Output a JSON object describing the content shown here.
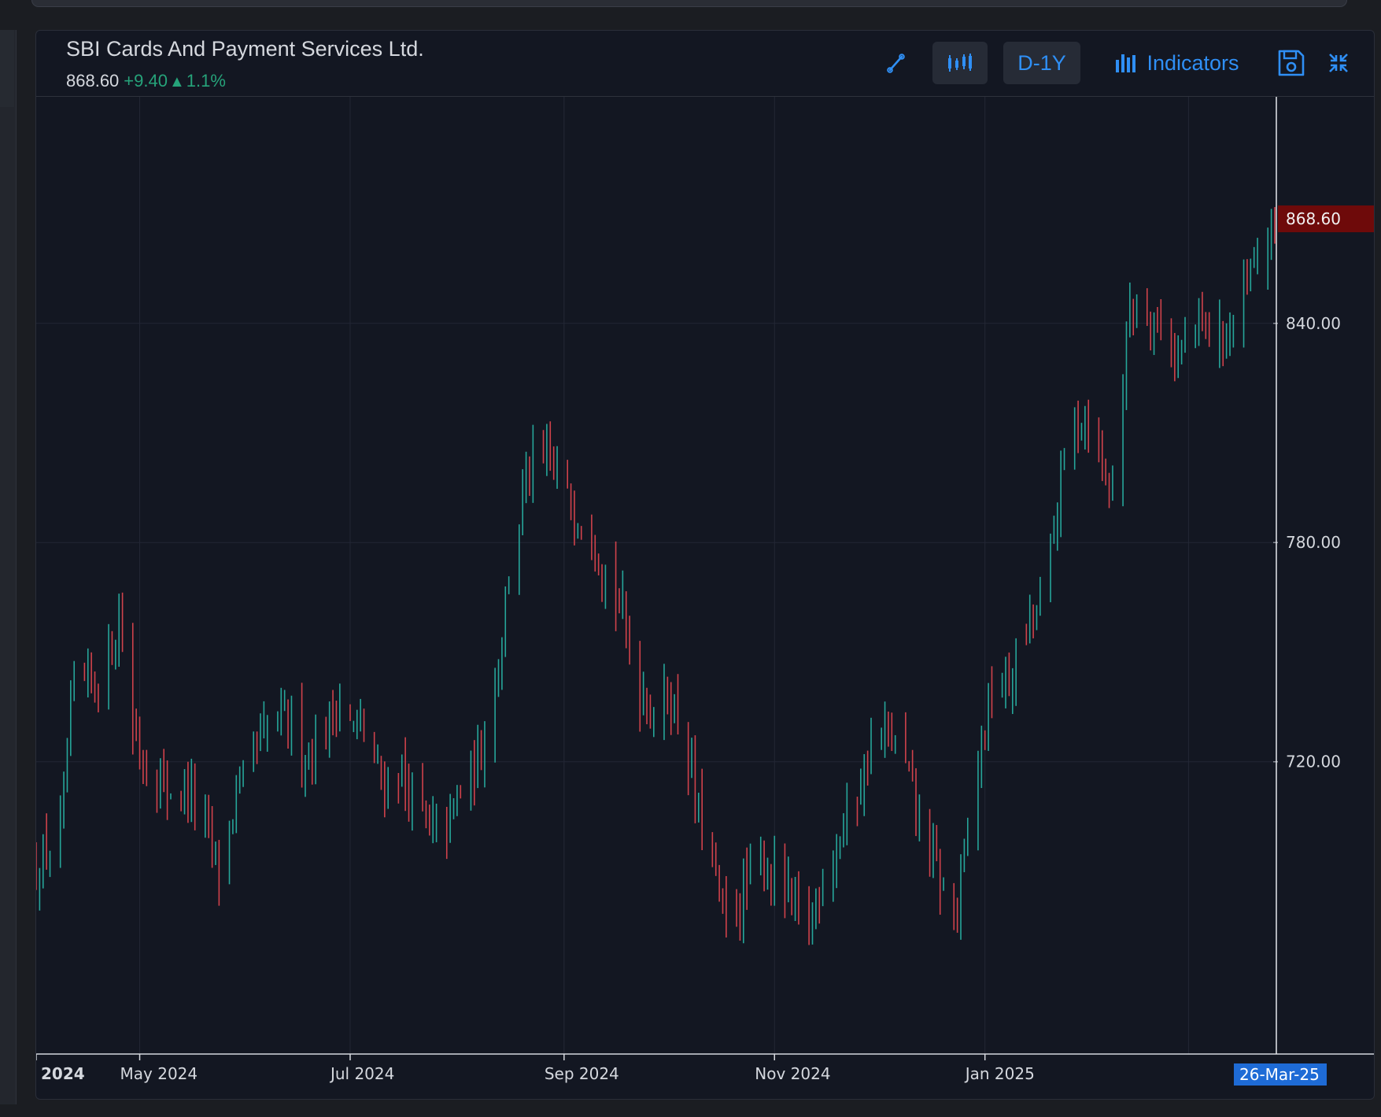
{
  "header": {
    "title": "SBI Cards And Payment Services Ltd.",
    "last_price": "868.60",
    "change": "+9.40",
    "change_pct": "1.1%",
    "change_arrow": "▲"
  },
  "toolbar": {
    "draw_icon": "trendline-icon",
    "chart_type_icon": "ohlc-bars-icon",
    "period_label": "D-1Y",
    "indicators_label": "Indicators",
    "save_icon": "save-icon",
    "collapse_icon": "collapse-icon"
  },
  "colors": {
    "up": "#26a69a",
    "down": "#d0424b",
    "background": "#131722",
    "accent": "#2f8ff5",
    "last_price_label_bg": "#6e0a0a"
  },
  "chart_data": {
    "type": "ohlc",
    "title": "",
    "xlabel": "",
    "ylabel": "",
    "ylim": [
      640,
      902
    ],
    "y_ticks": [
      "720.00",
      "780.00",
      "840.00"
    ],
    "x_ticks": [
      "2024",
      "May 2024",
      "Jul 2024",
      "Sep 2024",
      "Nov 2024",
      "Jan 2025"
    ],
    "x_range": [
      "2024-04-01",
      "2025-03-26"
    ],
    "last_price_label": "868.60",
    "crosshair_date": "26-Mar-25",
    "grid": true,
    "series": [
      {
        "name": "",
        "close_path": [
          [
            "2024-04-01",
            690
          ],
          [
            "2024-04-08",
            700
          ],
          [
            "2024-04-12",
            740
          ],
          [
            "2024-04-18",
            742
          ],
          [
            "2024-04-22",
            748
          ],
          [
            "2024-04-25",
            760
          ],
          [
            "2024-04-29",
            730
          ],
          [
            "2024-05-03",
            718
          ],
          [
            "2024-05-08",
            713
          ],
          [
            "2024-05-15",
            712
          ],
          [
            "2024-05-20",
            702
          ],
          [
            "2024-05-24",
            690
          ],
          [
            "2024-05-29",
            710
          ],
          [
            "2024-06-04",
            723
          ],
          [
            "2024-06-10",
            732
          ],
          [
            "2024-06-14",
            730
          ],
          [
            "2024-06-18",
            722
          ],
          [
            "2024-06-24",
            728
          ],
          [
            "2024-06-27",
            738
          ],
          [
            "2024-07-01",
            730
          ],
          [
            "2024-07-05",
            728
          ],
          [
            "2024-07-10",
            714
          ],
          [
            "2024-07-15",
            718
          ],
          [
            "2024-07-19",
            710
          ],
          [
            "2024-07-24",
            700
          ],
          [
            "2024-07-29",
            702
          ],
          [
            "2024-08-02",
            712
          ],
          [
            "2024-08-07",
            720
          ],
          [
            "2024-08-12",
            742
          ],
          [
            "2024-08-16",
            772
          ],
          [
            "2024-08-21",
            797
          ],
          [
            "2024-08-24",
            802
          ],
          [
            "2024-08-29",
            800
          ],
          [
            "2024-09-03",
            790
          ],
          [
            "2024-09-09",
            786
          ],
          [
            "2024-09-13",
            772
          ],
          [
            "2024-09-18",
            760
          ],
          [
            "2024-09-23",
            740
          ],
          [
            "2024-09-27",
            735
          ],
          [
            "2024-10-02",
            738
          ],
          [
            "2024-10-07",
            722
          ],
          [
            "2024-10-10",
            705
          ],
          [
            "2024-10-14",
            690
          ],
          [
            "2024-10-18",
            675
          ],
          [
            "2024-10-23",
            684
          ],
          [
            "2024-10-28",
            692
          ],
          [
            "2024-11-01",
            690
          ],
          [
            "2024-11-06",
            680
          ],
          [
            "2024-11-11",
            675
          ],
          [
            "2024-11-15",
            690
          ],
          [
            "2024-11-20",
            700
          ],
          [
            "2024-11-25",
            712
          ],
          [
            "2024-11-29",
            724
          ],
          [
            "2024-12-04",
            728
          ],
          [
            "2024-12-09",
            718
          ],
          [
            "2024-12-13",
            704
          ],
          [
            "2024-12-18",
            690
          ],
          [
            "2024-12-21",
            680
          ],
          [
            "2024-12-24",
            680
          ],
          [
            "2024-12-30",
            720
          ],
          [
            "2025-01-03",
            740
          ],
          [
            "2025-01-08",
            742
          ],
          [
            "2025-01-14",
            758
          ],
          [
            "2025-01-18",
            765
          ],
          [
            "2025-01-22",
            790
          ],
          [
            "2025-01-26",
            815
          ],
          [
            "2025-01-30",
            815
          ],
          [
            "2025-02-03",
            805
          ],
          [
            "2025-02-06",
            795
          ],
          [
            "2025-02-08",
            805
          ],
          [
            "2025-02-12",
            845
          ],
          [
            "2025-02-17",
            845
          ],
          [
            "2025-02-21",
            840
          ],
          [
            "2025-02-26",
            830
          ],
          [
            "2025-03-04",
            840
          ],
          [
            "2025-03-10",
            835
          ],
          [
            "2025-03-15",
            840
          ],
          [
            "2025-03-20",
            855
          ],
          [
            "2025-03-24",
            862
          ],
          [
            "2025-03-26",
            868.6
          ]
        ]
      }
    ]
  }
}
